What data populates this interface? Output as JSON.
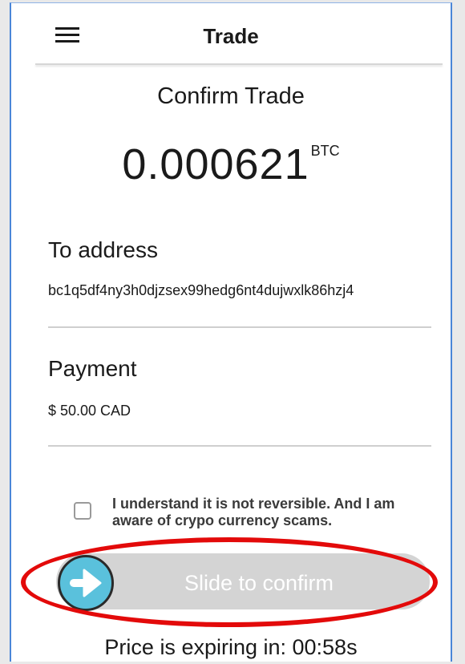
{
  "header": {
    "title": "Trade",
    "menu_icon": "hamburger-menu-icon"
  },
  "confirm": {
    "title": "Confirm Trade",
    "amount": "0.000621",
    "unit": "BTC"
  },
  "to_address": {
    "label": "To address",
    "value": "bc1q5df4ny3h0djzsex99hedg6nt4dujwxlk86hzj4"
  },
  "payment": {
    "label": "Payment",
    "value": "$ 50.00 CAD"
  },
  "agreement": {
    "checked": false,
    "label": "I understand it is not reversible. And I am aware of crypo currency scams."
  },
  "slider": {
    "label": "Slide to confirm",
    "knob_icon": "arrow-right-icon",
    "knob_color": "#5ac1dc",
    "track_color": "#d4d4d4"
  },
  "annotation": {
    "color": "#e30a0a"
  },
  "expiry": {
    "text": "Price is expiring in: 00:58s"
  }
}
